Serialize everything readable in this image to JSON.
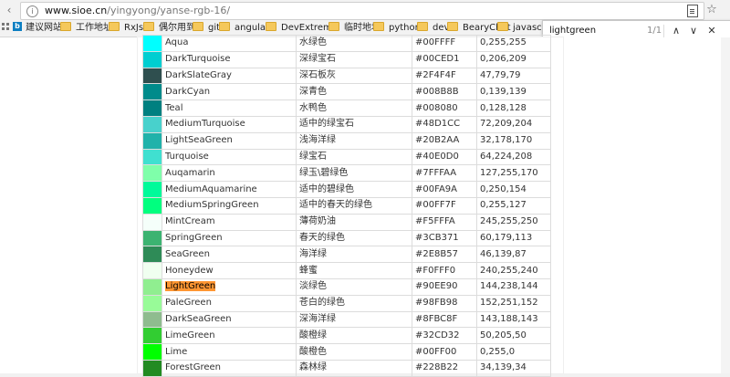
{
  "browser": {
    "url_host": "www.sioe.cn",
    "url_path": "/yingyong/yanse-rgb-16/"
  },
  "bookmarks": [
    {
      "label": "建议网站",
      "icon": "bing-icon"
    },
    {
      "label": "工作地址",
      "icon": "folder-icon"
    },
    {
      "label": "RxJs",
      "icon": "folder-icon"
    },
    {
      "label": "偶尔用到",
      "icon": "folder-icon"
    },
    {
      "label": "git",
      "icon": "folder-icon"
    },
    {
      "label": "angular",
      "icon": "folder-icon"
    },
    {
      "label": "DevExtreme",
      "icon": "folder-icon"
    },
    {
      "label": "临时地址",
      "icon": "folder-icon"
    },
    {
      "label": "python",
      "icon": "folder-icon"
    },
    {
      "label": "dev",
      "icon": "folder-icon"
    },
    {
      "label": "BearyChat",
      "icon": "folder-icon"
    },
    {
      "label": "javascript",
      "icon": "folder-icon"
    }
  ],
  "find": {
    "query": "lightgreen",
    "count": "1/1",
    "prev_glyph": "∧",
    "next_glyph": "∨",
    "close_glyph": "✕"
  },
  "colors": [
    {
      "name": "Aqua",
      "cn": "水绿色",
      "hex": "#00FFFF",
      "rgb": "0,255,255",
      "swatch": "#00FFFF"
    },
    {
      "name": "DarkTurquoise",
      "cn": "深绿宝石",
      "hex": "#00CED1",
      "rgb": "0,206,209",
      "swatch": "#00CED1"
    },
    {
      "name": "DarkSlateGray",
      "cn": "深石板灰",
      "hex": "#2F4F4F",
      "rgb": "47,79,79",
      "swatch": "#2F4F4F"
    },
    {
      "name": "DarkCyan",
      "cn": "深青色",
      "hex": "#008B8B",
      "rgb": "0,139,139",
      "swatch": "#008B8B"
    },
    {
      "name": "Teal",
      "cn": "水鸭色",
      "hex": "#008080",
      "rgb": "0,128,128",
      "swatch": "#008080"
    },
    {
      "name": "MediumTurquoise",
      "cn": "适中的绿宝石",
      "hex": "#48D1CC",
      "rgb": "72,209,204",
      "swatch": "#48D1CC"
    },
    {
      "name": "LightSeaGreen",
      "cn": "浅海洋绿",
      "hex": "#20B2AA",
      "rgb": "32,178,170",
      "swatch": "#20B2AA"
    },
    {
      "name": "Turquoise",
      "cn": "绿宝石",
      "hex": "#40E0D0",
      "rgb": "64,224,208",
      "swatch": "#40E0D0"
    },
    {
      "name": "Auqamarin",
      "cn": "绿玉\\碧绿色",
      "hex": "#7FFFAA",
      "rgb": "127,255,170",
      "swatch": "#7FFFAA"
    },
    {
      "name": "MediumAquamarine",
      "cn": "适中的碧绿色",
      "hex": "#00FA9A",
      "rgb": "0,250,154",
      "swatch": "#00FA9A"
    },
    {
      "name": "MediumSpringGreen",
      "cn": "适中的春天的绿色",
      "hex": "#00FF7F",
      "rgb": "0,255,127",
      "swatch": "#00FF7F"
    },
    {
      "name": "MintCream",
      "cn": "薄荷奶油",
      "hex": "#F5FFFA",
      "rgb": "245,255,250",
      "swatch": "#F5FFFA"
    },
    {
      "name": "SpringGreen",
      "cn": "春天的绿色",
      "hex": "#3CB371",
      "rgb": "60,179,113",
      "swatch": "#3CB371"
    },
    {
      "name": "SeaGreen",
      "cn": "海洋绿",
      "hex": "#2E8B57",
      "rgb": "46,139,87",
      "swatch": "#2E8B57"
    },
    {
      "name": "Honeydew",
      "cn": "蜂蜜",
      "hex": "#F0FFF0",
      "rgb": "240,255,240",
      "swatch": "#F0FFF0"
    },
    {
      "name": "LightGreen",
      "cn": "淡绿色",
      "hex": "#90EE90",
      "rgb": "144,238,144",
      "swatch": "#90EE90",
      "highlight": true
    },
    {
      "name": "PaleGreen",
      "cn": "苍白的绿色",
      "hex": "#98FB98",
      "rgb": "152,251,152",
      "swatch": "#98FB98"
    },
    {
      "name": "DarkSeaGreen",
      "cn": "深海洋绿",
      "hex": "#8FBC8F",
      "rgb": "143,188,143",
      "swatch": "#8FBC8F"
    },
    {
      "name": "LimeGreen",
      "cn": "酸橙绿",
      "hex": "#32CD32",
      "rgb": "50,205,50",
      "swatch": "#32CD32"
    },
    {
      "name": "Lime",
      "cn": "酸橙色",
      "hex": "#00FF00",
      "rgb": "0,255,0",
      "swatch": "#00FF00"
    },
    {
      "name": "ForestGreen",
      "cn": "森林绿",
      "hex": "#228B22",
      "rgb": "34,139,34",
      "swatch": "#228B22"
    }
  ]
}
